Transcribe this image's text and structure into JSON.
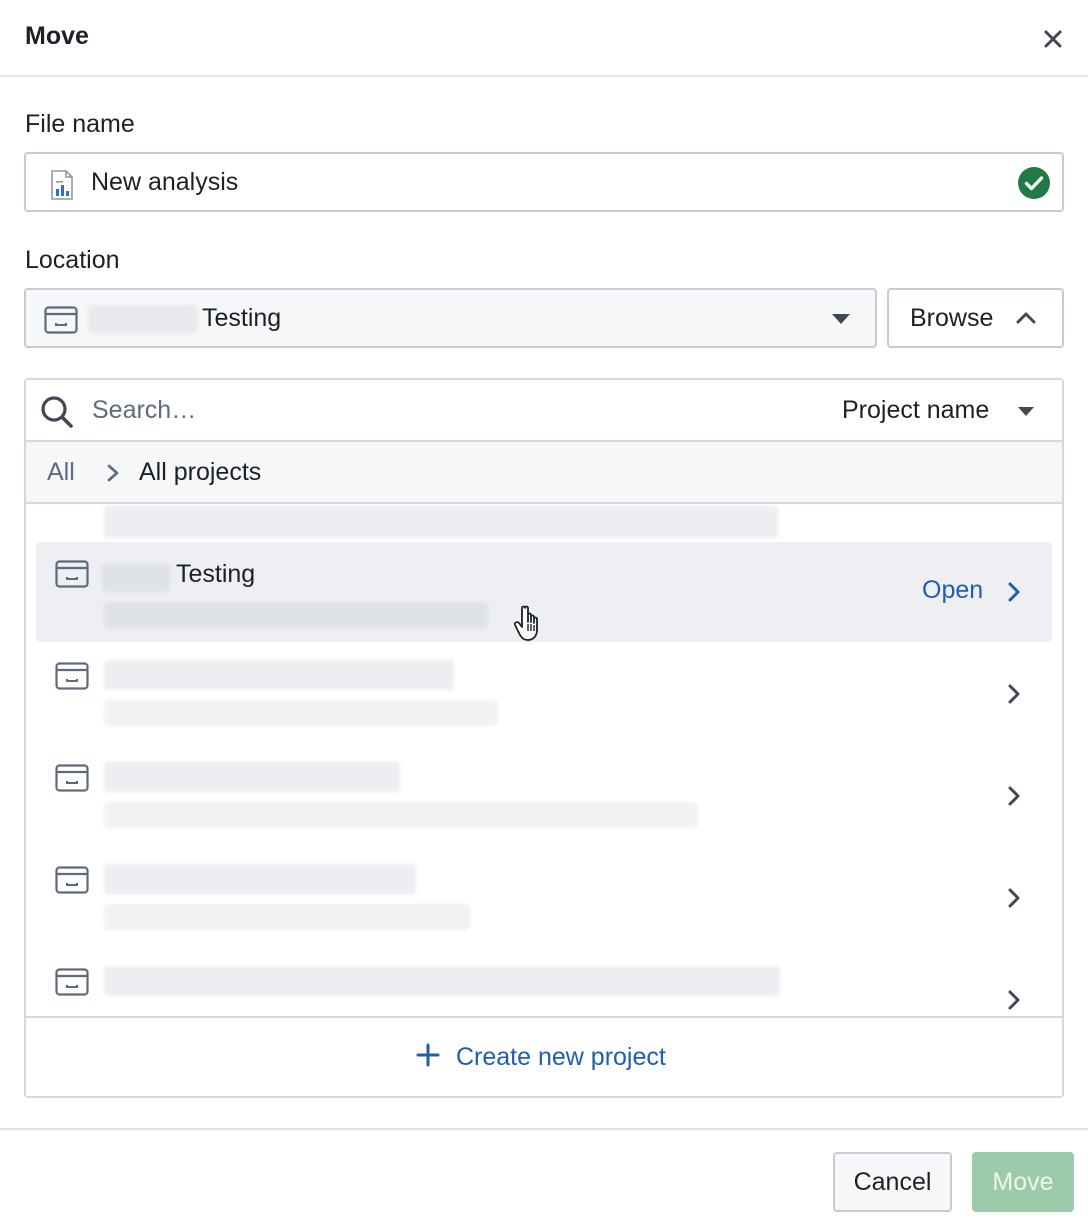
{
  "dialog": {
    "title": "Move"
  },
  "file_name": {
    "label": "File name",
    "value": "New analysis",
    "valid": true
  },
  "location": {
    "label": "Location",
    "selected_value": "Testing",
    "browse_label": "Browse"
  },
  "browser": {
    "search_placeholder": "Search…",
    "sort_label": "Project name",
    "breadcrumb": {
      "root": "All",
      "current": "All projects"
    },
    "rows": [
      {
        "title": "",
        "blurred": true,
        "active": false
      },
      {
        "title": "Testing",
        "blurred": false,
        "active": true,
        "action_label": "Open"
      },
      {
        "title": "",
        "blurred": true,
        "active": false
      },
      {
        "title": "",
        "blurred": true,
        "active": false
      },
      {
        "title": "",
        "blurred": true,
        "active": false
      },
      {
        "title": "",
        "blurred": true,
        "active": false
      }
    ],
    "create_label": "Create new project"
  },
  "footer": {
    "cancel_label": "Cancel",
    "move_label": "Move"
  },
  "colors": {
    "accent_blue": "#215db0",
    "success_green": "#1f7a46",
    "disabled_green": "#9ccba9"
  }
}
